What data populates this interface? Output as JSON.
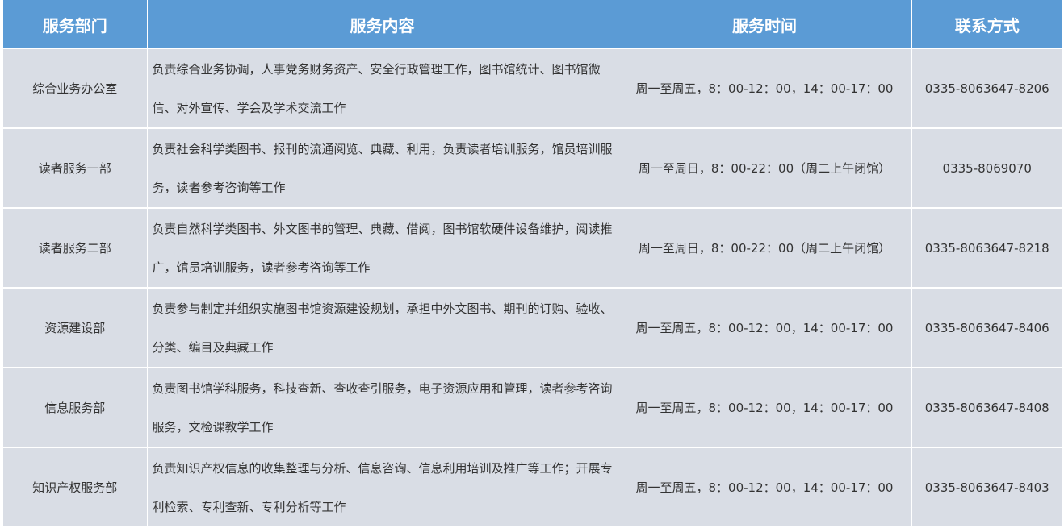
{
  "headers": {
    "department": "服务部门",
    "content": "服务内容",
    "hours": "服务时间",
    "contact": "联系方式"
  },
  "rows": [
    {
      "department": "综合业务办公室",
      "content": "负责综合业务协调，人事党务财务资产、安全行政管理工作，图书馆统计、图书馆微信、对外宣传、学会及学术交流工作",
      "hours": "周一至周五，8：00-12：00，14：00-17：00",
      "contact": "0335-8063647-8206"
    },
    {
      "department": "读者服务一部",
      "content": "负责社会科学类图书、报刊的流通阅览、典藏、利用，负责读者培训服务，馆员培训服务，读者参考咨询等工作",
      "hours": "周一至周日，8：00-22：00（周二上午闭馆）",
      "contact": "0335-8069070"
    },
    {
      "department": "读者服务二部",
      "content": "负责自然科学类图书、外文图书的管理、典藏、借阅，图书馆软硬件设备维护，阅读推广，馆员培训服务，读者参考咨询等工作",
      "hours": "周一至周日，8：00-22：00（周二上午闭馆）",
      "contact": "0335-8063647-8218"
    },
    {
      "department": "资源建设部",
      "content": "负责参与制定并组织实施图书馆资源建设规划，承担中外文图书、期刊的订购、验收、分类、编目及典藏工作",
      "hours": "周一至周五，8：00-12：00，14：00-17：00",
      "contact": "0335-8063647-8406"
    },
    {
      "department": "信息服务部",
      "content": "负责图书馆学科服务，科技查新、查收查引服务，电子资源应用和管理，读者参考咨询服务，文检课教学工作",
      "hours": "周一至周五，8：00-12：00，14：00-17：00",
      "contact": "0335-8063647-8408"
    },
    {
      "department": "知识产权服务部",
      "content": "负责知识产权信息的收集整理与分析、信息咨询、信息利用培训及推广等工作；开展专利检索、专利查新、专利分析等工作",
      "hours": "周一至周五，8：00-12：00，14：00-17：00",
      "contact": "0335-8063647-8403"
    }
  ]
}
